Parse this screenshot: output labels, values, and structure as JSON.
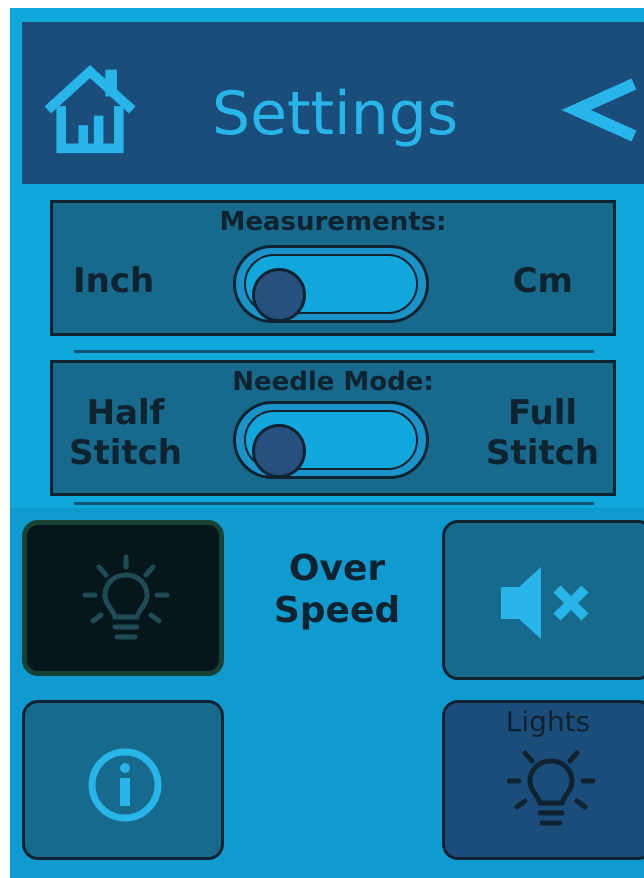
{
  "header": {
    "title": "Settings",
    "home_icon": "home-icon",
    "back_icon": "chevron-left-icon"
  },
  "measurements": {
    "title": "Measurements:",
    "left_label": "Inch",
    "right_label": "Cm",
    "selected": "Inch"
  },
  "needle_mode": {
    "title": "Needle Mode:",
    "left_label_line1": "Half",
    "left_label_line2": "Stitch",
    "right_label_line1": "Full",
    "right_label_line2": "Stitch",
    "selected": "Half Stitch"
  },
  "controls": {
    "over_speed_line1": "Over",
    "over_speed_line2": "Speed",
    "lights_label": "Lights",
    "mute_icon": "speaker-mute-icon",
    "info_icon": "info-icon",
    "light_icon": "lightbulb-icon"
  },
  "colors": {
    "background": "#10a7db",
    "header": "#1b4d7b",
    "accent_text": "#27b5ea",
    "dark": "#0f2230"
  }
}
